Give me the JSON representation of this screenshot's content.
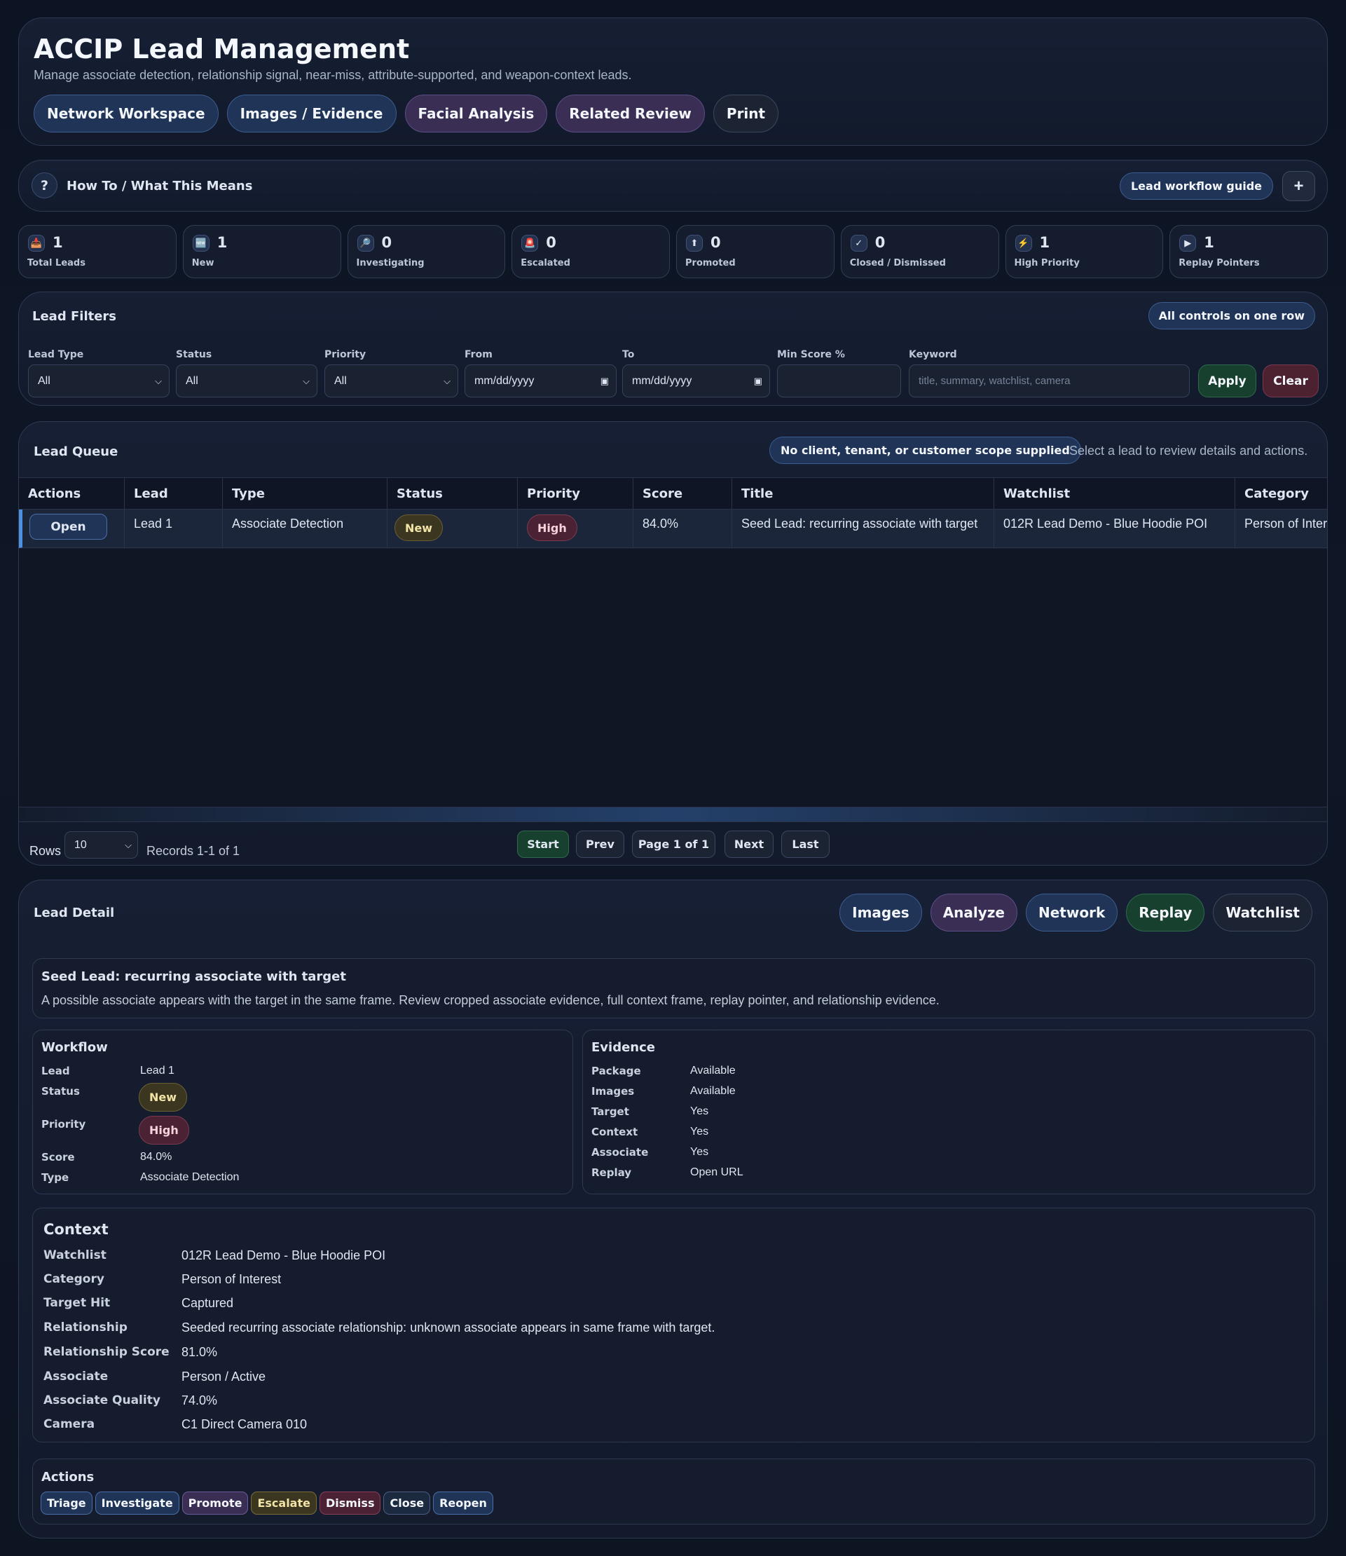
{
  "header": {
    "title": "ACCIP Lead Management",
    "subtitle": "Manage associate detection, relationship signal, near-miss, attribute-supported, and weapon-context leads.",
    "nav": [
      "Network Workspace",
      "Images / Evidence",
      "Facial Analysis",
      "Related Review",
      "Print"
    ]
  },
  "howto": {
    "icon": "?",
    "label": "How To / What This Means",
    "guide": "Lead workflow guide",
    "expand": "+"
  },
  "stats": [
    {
      "icon": "inbox-icon",
      "glyph": "📥",
      "value": "1",
      "label": "Total Leads"
    },
    {
      "icon": "new-icon",
      "glyph": "🆕",
      "value": "1",
      "label": "New"
    },
    {
      "icon": "magnifier-icon",
      "glyph": "🔎",
      "value": "0",
      "label": "Investigating"
    },
    {
      "icon": "siren-icon",
      "glyph": "🚨",
      "value": "0",
      "label": "Escalated"
    },
    {
      "icon": "arrow-up-icon",
      "glyph": "⬆",
      "value": "0",
      "label": "Promoted"
    },
    {
      "icon": "check-icon",
      "glyph": "✓",
      "value": "0",
      "label": "Closed / Dismissed"
    },
    {
      "icon": "lightning-icon",
      "glyph": "⚡",
      "value": "1",
      "label": "High Priority"
    },
    {
      "icon": "play-icon",
      "glyph": "▶",
      "value": "1",
      "label": "Replay Pointers"
    }
  ],
  "filters": {
    "title": "Lead Filters",
    "badge": "All controls on one row",
    "lead_type": {
      "label": "Lead Type",
      "value": "All"
    },
    "status": {
      "label": "Status",
      "value": "All"
    },
    "priority": {
      "label": "Priority",
      "value": "All"
    },
    "from": {
      "label": "From",
      "placeholder": "mm/dd/yyyy"
    },
    "to": {
      "label": "To",
      "placeholder": "mm/dd/yyyy"
    },
    "min_score": {
      "label": "Min Score %",
      "value": ""
    },
    "keyword": {
      "label": "Keyword",
      "placeholder": "title, summary, watchlist, camera"
    },
    "apply": "Apply",
    "clear": "Clear"
  },
  "queue": {
    "title": "Lead Queue",
    "scope": "No client, tenant, or customer scope supplied",
    "hint": "Select a lead to review details and actions.",
    "columns": [
      "Actions",
      "Lead",
      "Type",
      "Status",
      "Priority",
      "Score",
      "Title",
      "Watchlist",
      "Category"
    ],
    "rows": [
      {
        "action": "Open",
        "lead": "Lead 1",
        "type": "Associate Detection",
        "status": "New",
        "priority": "High",
        "score": "84.0%",
        "title": "Seed Lead: recurring associate with target",
        "watchlist": "012R Lead Demo - Blue Hoodie POI",
        "category": "Person of Interest"
      }
    ],
    "rows_label": "Rows",
    "rows_value": "10",
    "records": "Records 1-1 of 1",
    "pager": {
      "start": "Start",
      "prev": "Prev",
      "page": "Page 1 of 1",
      "next": "Next",
      "last": "Last"
    }
  },
  "detail": {
    "title": "Lead Detail",
    "buttons": [
      "Images",
      "Analyze",
      "Network",
      "Replay",
      "Watchlist"
    ],
    "summary_title": "Seed Lead: recurring associate with target",
    "summary_text": "A possible associate appears with the target in the same frame. Review cropped associate evidence, full context frame, replay pointer, and relationship evidence.",
    "workflow": {
      "title": "Workflow",
      "lead_k": "Lead",
      "lead_v": "Lead 1",
      "status_k": "Status",
      "status_v": "New",
      "priority_k": "Priority",
      "priority_v": "High",
      "score_k": "Score",
      "score_v": "84.0%",
      "type_k": "Type",
      "type_v": "Associate Detection"
    },
    "evidence": {
      "title": "Evidence",
      "items": [
        {
          "k": "Package",
          "v": "Available"
        },
        {
          "k": "Images",
          "v": "Available"
        },
        {
          "k": "Target",
          "v": "Yes"
        },
        {
          "k": "Context",
          "v": "Yes"
        },
        {
          "k": "Associate",
          "v": "Yes"
        },
        {
          "k": "Replay",
          "v": "Open URL"
        }
      ]
    },
    "context": {
      "title": "Context",
      "items": [
        {
          "k": "Watchlist",
          "v": "012R Lead Demo - Blue Hoodie POI"
        },
        {
          "k": "Category",
          "v": "Person of Interest"
        },
        {
          "k": "Target Hit",
          "v": "Captured"
        },
        {
          "k": "Relationship",
          "v": "Seeded recurring associate relationship: unknown associate appears in same frame with target."
        },
        {
          "k": "Relationship Score",
          "v": "81.0%"
        },
        {
          "k": "Associate",
          "v": "Person / Active"
        },
        {
          "k": "Associate Quality",
          "v": "74.0%"
        },
        {
          "k": "Camera",
          "v": "C1 Direct Camera 010"
        }
      ]
    },
    "actions": {
      "title": "Actions",
      "items": [
        "Triage",
        "Investigate",
        "Promote",
        "Escalate",
        "Dismiss",
        "Close",
        "Reopen"
      ]
    }
  }
}
